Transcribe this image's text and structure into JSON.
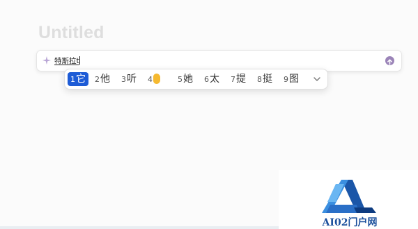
{
  "document": {
    "title": "Untitled"
  },
  "ai_bar": {
    "input_text": "特斯拉t",
    "sparkle_icon": "sparkle-icon",
    "send_icon": "arrow-up-circle-icon",
    "accent_color": "#9b84b8"
  },
  "ime": {
    "candidates": [
      {
        "num": "1",
        "text": "它",
        "selected": true
      },
      {
        "num": "2",
        "text": "他"
      },
      {
        "num": "3",
        "text": "听"
      },
      {
        "num": "4",
        "text": "",
        "icon": "emoji-face-icon"
      },
      {
        "num": "5",
        "text": "她"
      },
      {
        "num": "6",
        "text": "太"
      },
      {
        "num": "7",
        "text": "提"
      },
      {
        "num": "8",
        "text": "挺"
      },
      {
        "num": "9",
        "text": "图"
      }
    ],
    "expand_icon": "chevron-down-icon",
    "selected_color": "#1e5cd6"
  },
  "watermark": {
    "text": "AI02门户网",
    "logo_icon": "ai02-logo-icon"
  }
}
